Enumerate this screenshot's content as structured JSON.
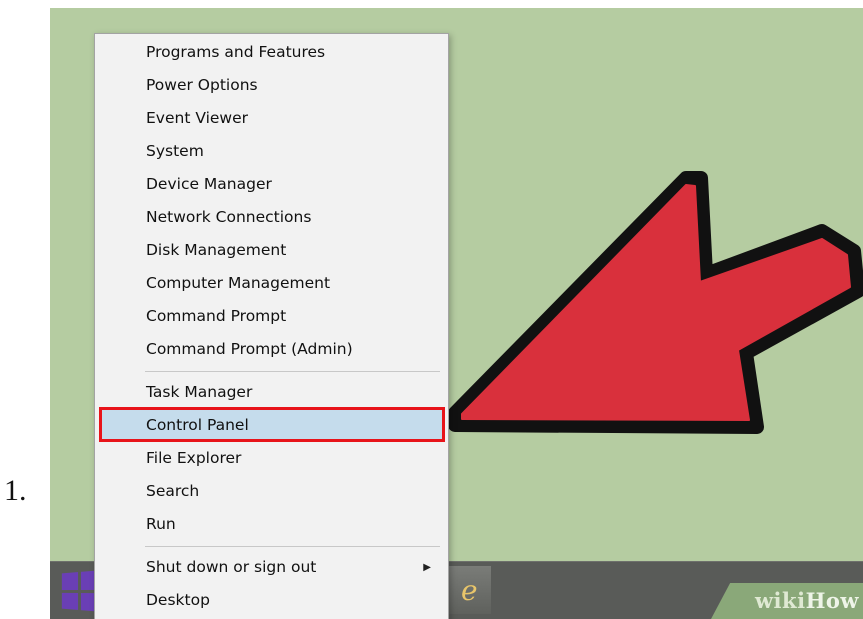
{
  "step_number": "1.",
  "context_menu": {
    "groups": [
      {
        "items": [
          {
            "label": "Programs and Features"
          },
          {
            "label": "Power Options"
          },
          {
            "label": "Event Viewer"
          },
          {
            "label": "System"
          },
          {
            "label": "Device Manager"
          },
          {
            "label": "Network Connections"
          },
          {
            "label": "Disk Management"
          },
          {
            "label": "Computer Management"
          },
          {
            "label": "Command Prompt"
          },
          {
            "label": "Command Prompt (Admin)"
          }
        ]
      },
      {
        "items": [
          {
            "label": "Task Manager"
          },
          {
            "label": "Control Panel",
            "highlighted": true
          },
          {
            "label": "File Explorer"
          },
          {
            "label": "Search"
          },
          {
            "label": "Run"
          }
        ]
      },
      {
        "items": [
          {
            "label": "Shut down or sign out",
            "has_submenu": true
          },
          {
            "label": "Desktop"
          }
        ]
      }
    ],
    "highlight_color": "#c5dcec",
    "callout_color": "#e8141a"
  },
  "arrow": {
    "color": "#d9303c",
    "outline_color": "#111111",
    "points_to": "Control Panel"
  },
  "taskbar": {
    "start_icon": "windows-logo-icon",
    "start_color": "#6a3fb5",
    "pinned_app_icon": "internet-explorer-icon"
  },
  "watermark": {
    "text_bold": "wiki",
    "text_light": "How"
  },
  "colors": {
    "desktop_background": "#b5cca1",
    "taskbar": "#595b58",
    "menu_background": "#f2f2f2"
  }
}
